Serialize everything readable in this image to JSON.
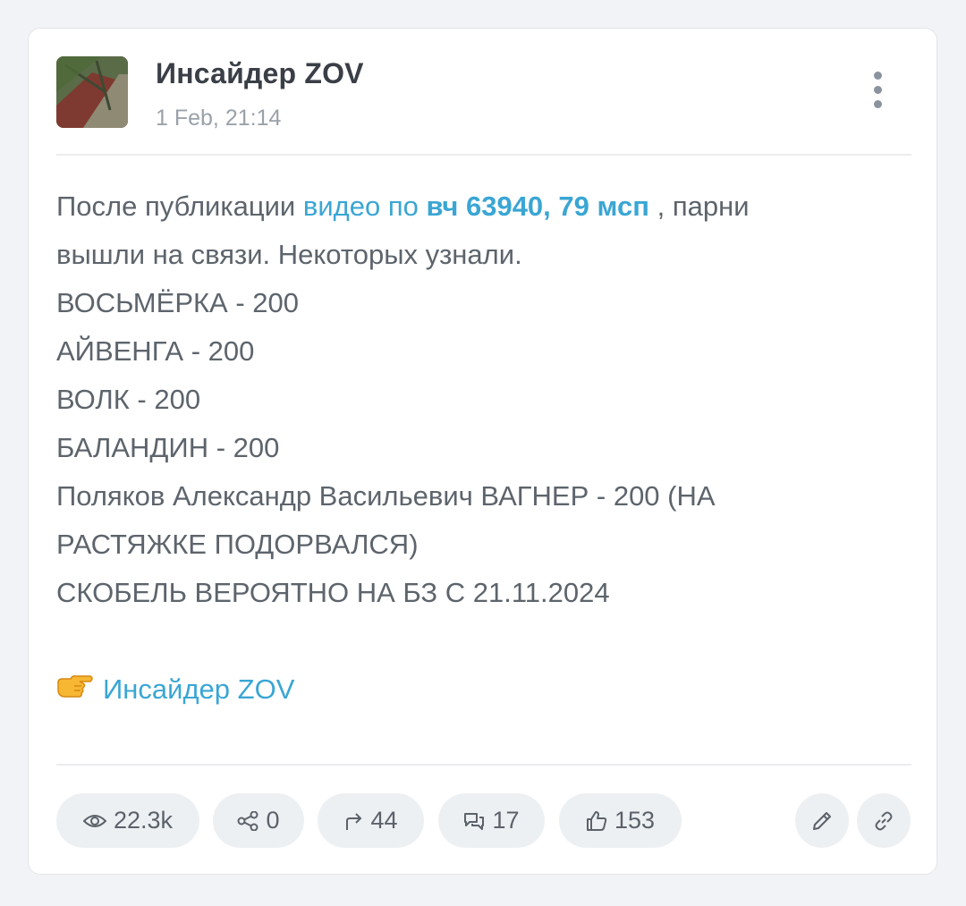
{
  "post": {
    "channel_name": "Инсайдер ZOV",
    "date": "1 Feb, 21:14",
    "text": {
      "intro": "После публикации ",
      "link_video": "видео по",
      "link_unit": "вч 63940, 79 мсп",
      "after_link": " , парни",
      "line2": "вышли на связи. Некоторых узнали.",
      "line3": "ВОСЬМЁРКА - 200",
      "line4": "АЙВЕНГА - 200",
      "line5": "ВОЛК - 200",
      "line6": "БАЛАНДИН - 200",
      "line7": "Поляков Александр Васильевич ВАГНЕР - 200 (НА",
      "line8": "РАСТЯЖКЕ ПОДОРВАЛСЯ)",
      "line9": "СКОБЕЛЬ ВЕРОЯТНО НА БЗ С 21.11.2024"
    },
    "signature": "Инсайдер ZOV",
    "signature_icon": "pointing-hand-icon"
  },
  "stats": {
    "views": "22.3k",
    "shares": "0",
    "forwards": "44",
    "comments": "17",
    "reactions": "153"
  },
  "icons": {
    "menu": "kebab-menu-icon",
    "views": "eye-icon",
    "shares": "share-icon",
    "forwards": "forward-arrow-icon",
    "comments": "comments-icon",
    "reactions": "thumbs-up-icon",
    "edit": "pencil-icon",
    "link": "link-icon"
  },
  "colors": {
    "link": "#3aa6d4",
    "text": "#5d646c",
    "title": "#3a3f47",
    "muted": "#9aa1a9",
    "pill_bg": "#edf0f3",
    "page_bg": "#f1f3f6"
  }
}
